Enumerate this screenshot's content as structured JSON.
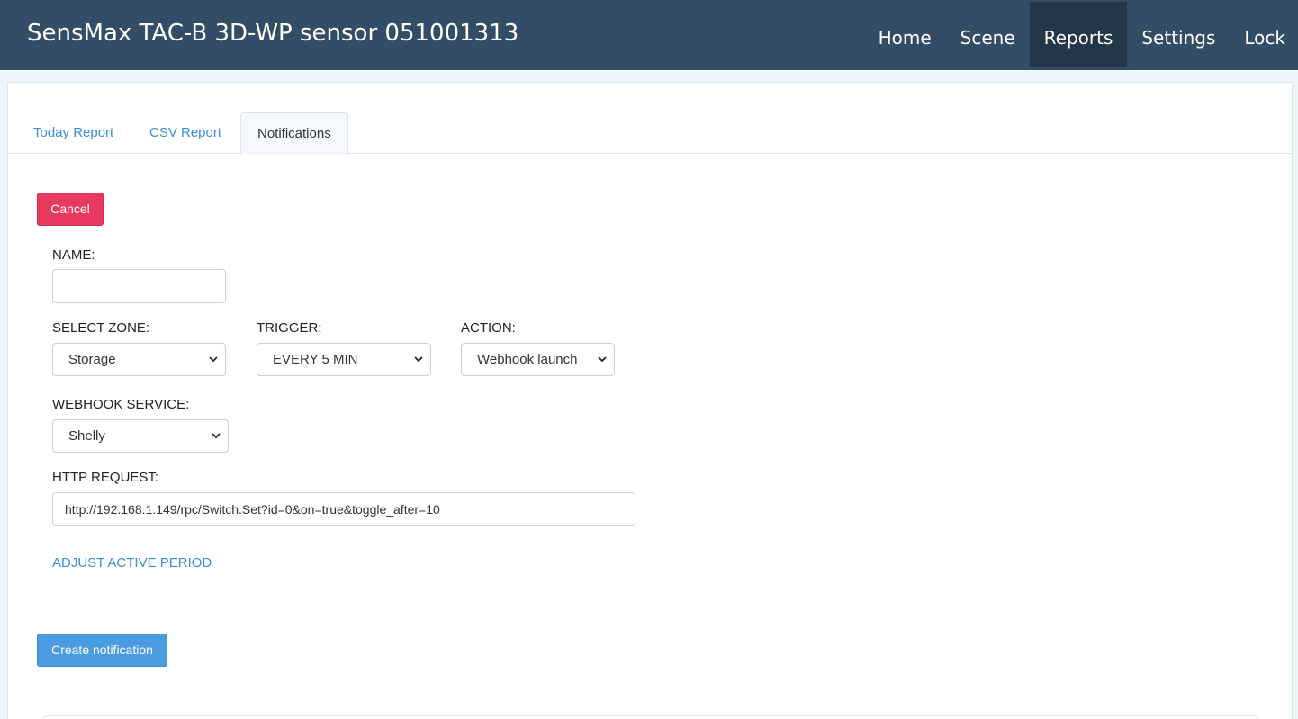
{
  "header": {
    "title": "SensMax TAC-B 3D-WP sensor 051001313",
    "nav": [
      "Home",
      "Scene",
      "Reports",
      "Settings",
      "Lock"
    ]
  },
  "tabs": [
    "Today Report",
    "CSV Report",
    "Notifications"
  ],
  "form": {
    "cancel_label": "Cancel",
    "name_label": "NAME:",
    "name_value": "",
    "zone_label": "SELECT ZONE:",
    "zone_value": "Storage",
    "trigger_label": "TRIGGER:",
    "trigger_value": "EVERY 5 MIN",
    "action_label": "ACTION:",
    "action_value": "Webhook launch",
    "webhook_label": "WEBHOOK SERVICE:",
    "webhook_value": "Shelly",
    "http_label": "HTTP REQUEST:",
    "http_value": "http://192.168.1.149/rpc/Switch.Set?id=0&on=true&toggle_after=10",
    "adjust_link": "ADJUST ACTIVE PERIOD",
    "create_label": "Create notification"
  },
  "icons": {
    "select_chevron": "chevron-down-icon"
  },
  "colors": {
    "navbar": "#334d66",
    "nav_active": "#233748",
    "cancel": "#e8395e",
    "primary": "#4a9be0",
    "link": "#3a8fd6"
  }
}
